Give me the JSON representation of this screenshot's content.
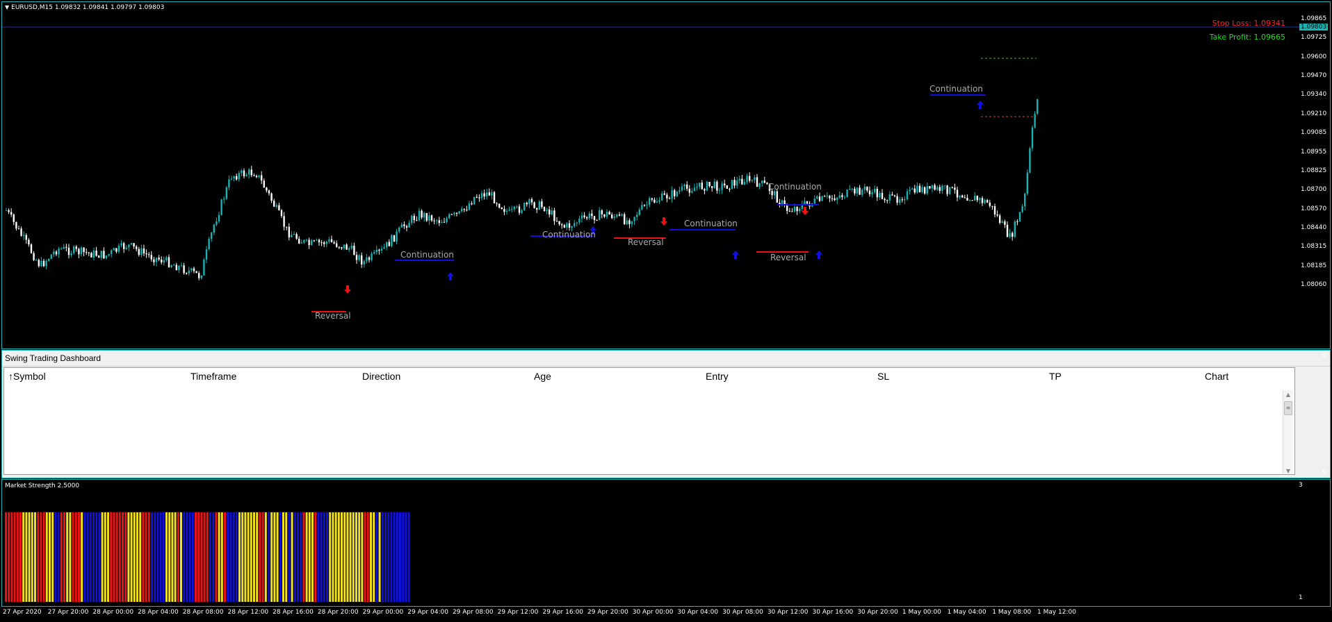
{
  "chart_title": "EURUSD,M15  1.09832 1.09841 1.09797 1.09803",
  "stop_loss": "Stop Loss: 1.09341",
  "take_profit": "Take Profit: 1.09665",
  "current_price": "1.09803",
  "price_ticks": [
    "1.09865",
    "1.09725",
    "1.09600",
    "1.09470",
    "1.09340",
    "1.09210",
    "1.09085",
    "1.08955",
    "1.08825",
    "1.08700",
    "1.08570",
    "1.08440",
    "1.08315",
    "1.08185",
    "1.08060"
  ],
  "annotations": [
    {
      "text": "Reversal",
      "type": "reversal"
    },
    {
      "text": "Continuation",
      "type": "continuation"
    },
    {
      "text": "Continuation",
      "type": "continuation"
    },
    {
      "text": "Reversal",
      "type": "reversal"
    },
    {
      "text": "Continuation",
      "type": "continuation"
    },
    {
      "text": "Continuation",
      "type": "continuation"
    },
    {
      "text": "Reversal",
      "type": "reversal"
    },
    {
      "text": "Continuation",
      "type": "continuation"
    }
  ],
  "dashboard": {
    "title": "Swing Trading Dashboard",
    "sort_icon": "↑",
    "columns": [
      "Symbol",
      "Timeframe",
      "Direction",
      "Age",
      "Entry",
      "SL",
      "TP",
      "Chart"
    ],
    "scroll_up": "▲",
    "scroll_thumb": "≡",
    "scroll_down": "▼",
    "axis_top": "0",
    "axis_bottom": "0"
  },
  "strength": {
    "title": "Market Strength 2.5000",
    "axis_top": "3",
    "axis_bottom": "1"
  },
  "time_labels": [
    "27 Apr 2020",
    "27 Apr 20:00",
    "28 Apr 00:00",
    "28 Apr 04:00",
    "28 Apr 08:00",
    "28 Apr 12:00",
    "28 Apr 16:00",
    "28 Apr 20:00",
    "29 Apr 00:00",
    "29 Apr 04:00",
    "29 Apr 08:00",
    "29 Apr 12:00",
    "29 Apr 16:00",
    "29 Apr 20:00",
    "30 Apr 00:00",
    "30 Apr 04:00",
    "30 Apr 08:00",
    "30 Apr 12:00",
    "30 Apr 16:00",
    "30 Apr 20:00",
    "1 May 00:00",
    "1 May 04:00",
    "1 May 08:00",
    "1 May 12:00"
  ],
  "colors": {
    "bull": "#1ab3b3",
    "bear": "#ffffff",
    "red": "#ee1111",
    "yellow": "#f0e020",
    "blue": "#1010dd",
    "grid": "#1ab3b3"
  },
  "strength_segments": [
    [
      "red",
      6
    ],
    [
      "yellow",
      5
    ],
    [
      "red",
      3
    ],
    [
      "yellow",
      3
    ],
    [
      "blue",
      2
    ],
    [
      "red",
      2
    ],
    [
      "yellow",
      2
    ],
    [
      "red",
      3
    ],
    [
      "yellow",
      1
    ],
    [
      "blue",
      6
    ],
    [
      "yellow",
      3
    ],
    [
      "red",
      6
    ],
    [
      "yellow",
      5
    ],
    [
      "red",
      3
    ],
    [
      "blue",
      5
    ],
    [
      "yellow",
      4
    ],
    [
      "red",
      1
    ],
    [
      "yellow",
      1
    ],
    [
      "blue",
      4
    ],
    [
      "red",
      5
    ],
    [
      "blue",
      2
    ],
    [
      "red",
      1
    ],
    [
      "yellow",
      2
    ],
    [
      "red",
      1
    ],
    [
      "blue",
      4
    ],
    [
      "yellow",
      7
    ],
    [
      "red",
      2
    ],
    [
      "yellow",
      1
    ],
    [
      "blue",
      1
    ],
    [
      "yellow",
      3
    ],
    [
      "blue",
      1
    ],
    [
      "yellow",
      2
    ],
    [
      "blue",
      1
    ],
    [
      "yellow",
      1
    ],
    [
      "blue",
      3
    ],
    [
      "red",
      1
    ],
    [
      "yellow",
      3
    ],
    [
      "red",
      1
    ],
    [
      "blue",
      4
    ],
    [
      "yellow",
      12
    ],
    [
      "red",
      2
    ],
    [
      "yellow",
      2
    ],
    [
      "blue",
      1
    ],
    [
      "yellow",
      1
    ],
    [
      "blue",
      10
    ]
  ]
}
